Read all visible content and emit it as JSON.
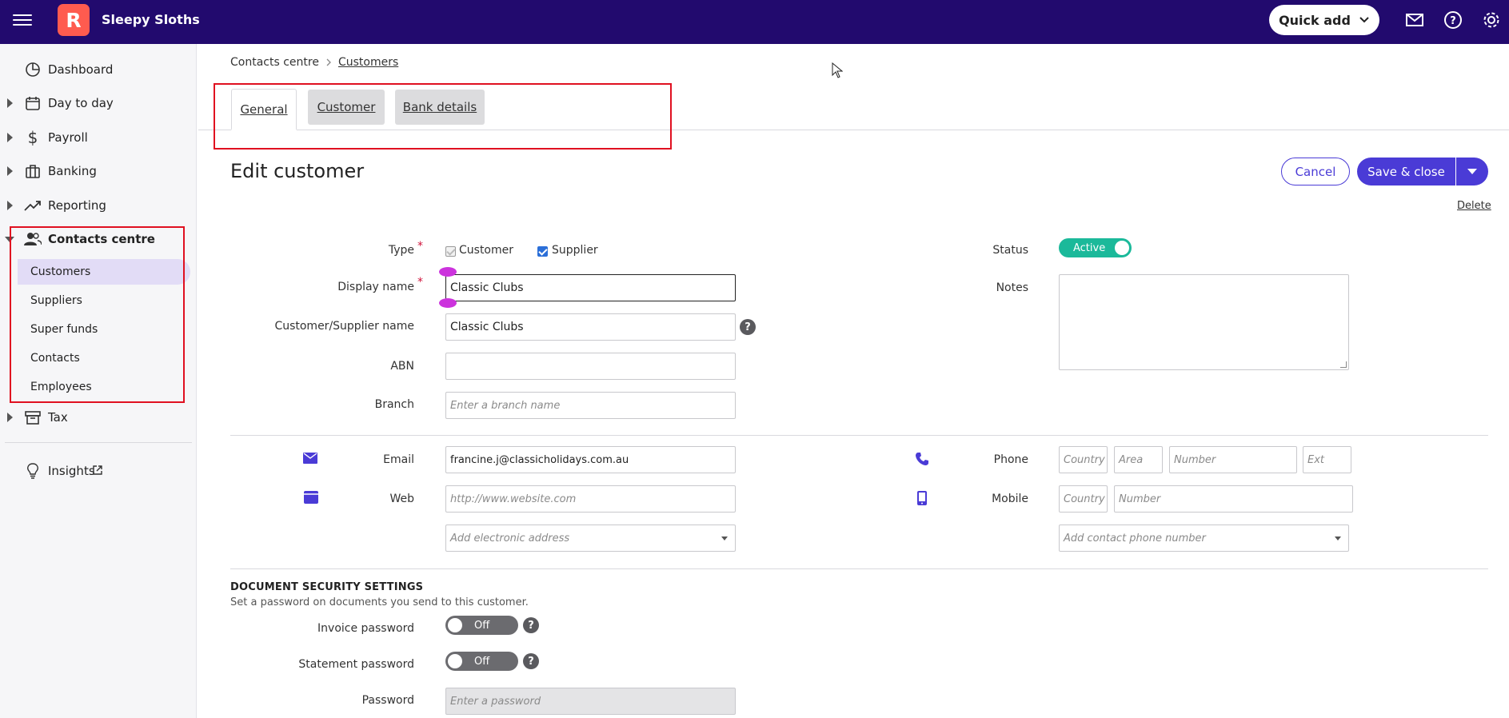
{
  "app": {
    "brand": "Sleepy Sloths",
    "logo_letter": "R",
    "quick_add": "Quick add"
  },
  "sidebar": {
    "items": [
      {
        "label": "Dashboard",
        "icon": "dashboard-icon"
      },
      {
        "label": "Day to day",
        "icon": "calendar-icon"
      },
      {
        "label": "Payroll",
        "icon": "dollar-icon"
      },
      {
        "label": "Banking",
        "icon": "bank-icon"
      },
      {
        "label": "Reporting",
        "icon": "chart-line-icon"
      },
      {
        "label": "Contacts centre",
        "icon": "people-icon"
      },
      {
        "label": "Tax",
        "icon": "archive-icon"
      },
      {
        "label": "Insights",
        "icon": "lightbulb-icon"
      }
    ],
    "sub_items": [
      "Customers",
      "Suppliers",
      "Super funds",
      "Contacts",
      "Employees"
    ]
  },
  "breadcrumb": {
    "parent": "Contacts centre",
    "current": "Customers"
  },
  "tabs": [
    "General",
    "Customer",
    "Bank details"
  ],
  "page": {
    "title": "Edit customer",
    "cancel": "Cancel",
    "save": "Save & close",
    "delete": "Delete"
  },
  "form": {
    "type_label": "Type",
    "type_customer": "Customer",
    "type_supplier": "Supplier",
    "display_name_label": "Display name",
    "display_name_value": "Classic Clubs",
    "cs_name_label": "Customer/Supplier name",
    "cs_name_value": "Classic Clubs",
    "abn_label": "ABN",
    "abn_value": "",
    "branch_label": "Branch",
    "branch_placeholder": "Enter a branch name",
    "status_label": "Status",
    "status_value": "Active",
    "notes_label": "Notes",
    "email_label": "Email",
    "email_value": "francine.j@classicholidays.com.au",
    "web_label": "Web",
    "web_placeholder": "http://www.website.com",
    "electronic_placeholder": "Add electronic address",
    "phone_label": "Phone",
    "phone_country": "Country",
    "phone_area": "Area",
    "phone_number": "Number",
    "phone_ext": "Ext",
    "mobile_label": "Mobile",
    "mobile_country": "Country",
    "mobile_number": "Number",
    "contact_phone_placeholder": "Add contact phone number"
  },
  "security": {
    "title": "DOCUMENT SECURITY SETTINGS",
    "subtitle": "Set a password on documents you send to this customer.",
    "invoice_label": "Invoice password",
    "invoice_value": "Off",
    "statement_label": "Statement password",
    "statement_value": "Off",
    "password_label": "Password",
    "password_placeholder": "Enter a password"
  },
  "colors": {
    "topbar": "#220a6e",
    "accent": "#4a3bd6",
    "logo": "#ff5b4f",
    "active_toggle": "#1bb99a"
  }
}
